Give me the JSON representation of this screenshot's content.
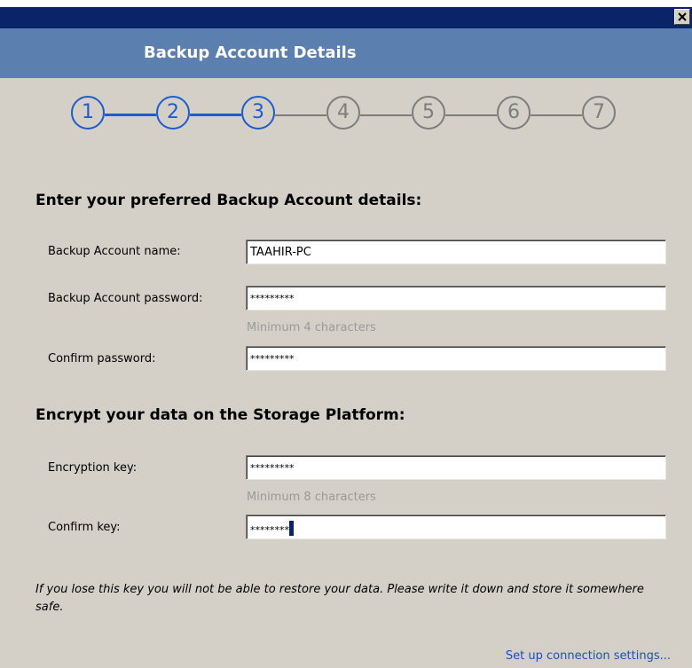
{
  "window": {
    "title": "Backup Account Details",
    "close_label": "×"
  },
  "steps": {
    "items": [
      "1",
      "2",
      "3",
      "4",
      "5",
      "6",
      "7"
    ],
    "current": 3,
    "active_color": "#1f5cc9",
    "inactive_color": "#7d7d7d"
  },
  "account_section": {
    "heading": "Enter your preferred Backup Account details:",
    "name_label": "Backup Account name:",
    "name_value": "TAAHIR-PC",
    "password_label": "Backup Account password:",
    "password_value": "*********",
    "password_hint": "Minimum 4 characters",
    "confirm_label": "Confirm password:",
    "confirm_value": "*********"
  },
  "encryption_section": {
    "heading": "Encrypt your data on the Storage Platform:",
    "key_label": "Encryption key:",
    "key_value": "*********",
    "key_hint": "Minimum 8 characters",
    "confirm_key_label": "Confirm key:",
    "confirm_key_value": "********"
  },
  "warning_text": "If you lose this key you will not be able to restore your data. Please write it down and store it somewhere safe.",
  "connection_link": "Set up connection settings...",
  "colors": {
    "titlebar": "#0a246a",
    "header_band": "#5b7fae",
    "dialog_bg": "#d4d0c8",
    "link": "#1c4fbf"
  }
}
